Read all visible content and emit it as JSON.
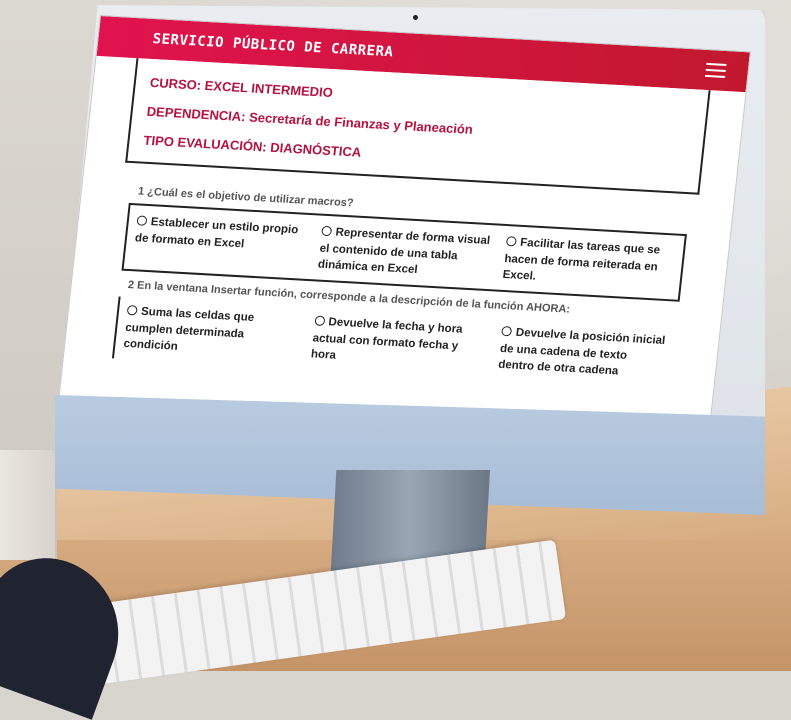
{
  "header": {
    "title": "SERVICIO PÚBLICO DE CARRERA",
    "menu_icon": "hamburger-menu-icon"
  },
  "course_info": {
    "course": "CURSO: EXCEL INTERMEDIO",
    "department": "DEPENDENCIA: Secretaría de Finanzas y Planeación",
    "evaluation_type": "TIPO EVALUACIÓN: DIAGNÓSTICA"
  },
  "questions": [
    {
      "text": "1 ¿Cuál es el objetivo de utilizar macros?",
      "options": [
        "Establecer un estilo propio de formato en Excel",
        "Representar de forma visual el contenido de una tabla dinámica en Excel",
        "Facilitar las tareas que se hacen de forma reiterada en Excel."
      ]
    },
    {
      "text": "2 En la ventana Insertar función, corresponde a la descripción de la función AHORA:",
      "options": [
        "Suma las celdas que cumplen determinada condición",
        "Devuelve la fecha y hora actual con formato fecha y hora",
        "Devuelve la posición inicial de una cadena de texto dentro de otra cadena"
      ]
    }
  ],
  "colors": {
    "header_start": "#e0134f",
    "header_end": "#c2182e",
    "info_text": "#b5123e"
  }
}
